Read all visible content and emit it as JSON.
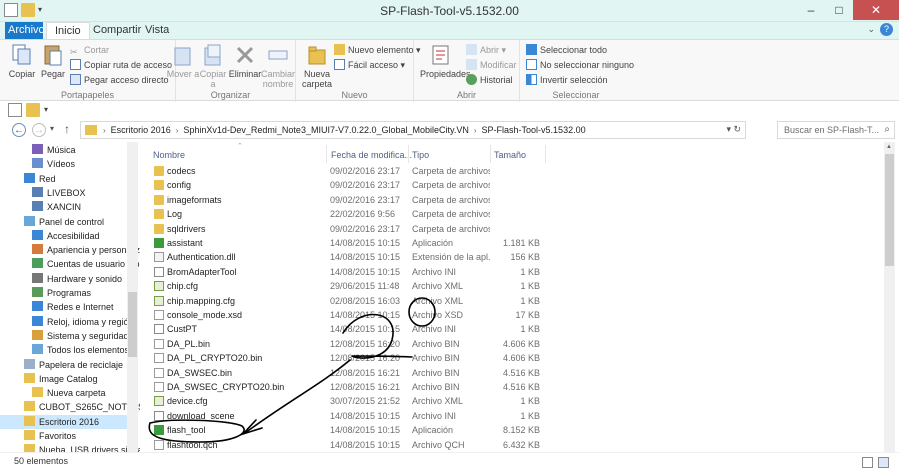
{
  "window": {
    "title": "SP-Flash-Tool-v5.1532.00",
    "minimize": "–",
    "maximize": "□",
    "close": "✕"
  },
  "tabs": [
    "Archivo",
    "Inicio",
    "Compartir",
    "Vista"
  ],
  "ribbon": {
    "portapapeles": {
      "label": "Portapapeles",
      "copiar": "Copiar",
      "pegar": "Pegar",
      "cortar": "Cortar",
      "copiar_ruta": "Copiar ruta de acceso",
      "pegar_acceso": "Pegar acceso directo"
    },
    "organizar": {
      "label": "Organizar",
      "mover": "Mover a",
      "copiar": "Copiar a",
      "eliminar": "Eliminar",
      "cambiar": "Cambiar nombre"
    },
    "nuevo": {
      "label": "Nuevo",
      "nueva_carpeta": "Nueva carpeta",
      "nuevo_elemento": "Nuevo elemento",
      "facil_acceso": "Fácil acceso"
    },
    "abrir": {
      "label": "Abrir",
      "propiedades": "Propiedades",
      "abrir": "Abrir",
      "modificar": "Modificar",
      "historial": "Historial"
    },
    "seleccionar": {
      "label": "Seleccionar",
      "todo": "Seleccionar todo",
      "ninguno": "No seleccionar ninguno",
      "invertir": "Invertir selección"
    }
  },
  "address": {
    "crumbs": [
      "Escritorio 2016",
      "SphinXv1d-Dev_Redmi_Note3_MIUI7-V7.0.22.0_Global_MobileCity.VN",
      "SP-Flash-Tool-v5.1532.00"
    ],
    "search_placeholder": "Buscar en SP-Flash-T..."
  },
  "nav_tree": [
    {
      "label": "Música",
      "icon": "music-icon"
    },
    {
      "label": "Vídeos",
      "icon": "video-icon"
    },
    {
      "label": "Red",
      "icon": "network-icon"
    },
    {
      "label": "LIVEBOX",
      "icon": "computer-icon"
    },
    {
      "label": "XANCIN",
      "icon": "computer-icon"
    },
    {
      "label": "Panel de control",
      "icon": "control-panel-icon"
    },
    {
      "label": "Accesibilidad",
      "icon": "accessibility-icon"
    },
    {
      "label": "Apariencia y personaliz",
      "icon": "appearance-icon"
    },
    {
      "label": "Cuentas de usuario y p",
      "icon": "user-accounts-icon"
    },
    {
      "label": "Hardware y sonido",
      "icon": "hardware-icon"
    },
    {
      "label": "Programas",
      "icon": "programs-icon"
    },
    {
      "label": "Redes e Internet",
      "icon": "network-icon"
    },
    {
      "label": "Reloj, idioma y región",
      "icon": "clock-icon"
    },
    {
      "label": "Sistema y seguridad",
      "icon": "security-icon"
    },
    {
      "label": "Todos los elementos d",
      "icon": "control-panel-icon"
    },
    {
      "label": "Papelera de reciclaje",
      "icon": "recycle-bin-icon"
    },
    {
      "label": "Image Catalog",
      "icon": "folder-icon"
    },
    {
      "label": "Nueva carpeta",
      "icon": "folder-icon"
    },
    {
      "label": "CUBOT_S265C_NOTE_S_",
      "icon": "folder-icon"
    },
    {
      "label": "Escritorio 2016",
      "icon": "folder-icon"
    },
    {
      "label": "Favoritos",
      "icon": "folder-icon"
    },
    {
      "label": "Nueba_USB drivers signa",
      "icon": "folder-icon"
    }
  ],
  "columns": {
    "name": "Nombre",
    "date": "Fecha de modifica...",
    "type": "Tipo",
    "size": "Tamaño"
  },
  "files": [
    {
      "name": "codecs",
      "date": "09/02/2016 23:17",
      "type": "Carpeta de archivos",
      "size": "",
      "kind": "folder"
    },
    {
      "name": "config",
      "date": "09/02/2016 23:17",
      "type": "Carpeta de archivos",
      "size": "",
      "kind": "folder"
    },
    {
      "name": "imageformats",
      "date": "09/02/2016 23:17",
      "type": "Carpeta de archivos",
      "size": "",
      "kind": "folder"
    },
    {
      "name": "Log",
      "date": "22/02/2016 9:56",
      "type": "Carpeta de archivos",
      "size": "",
      "kind": "folder"
    },
    {
      "name": "sqldrivers",
      "date": "09/02/2016 23:17",
      "type": "Carpeta de archivos",
      "size": "",
      "kind": "folder"
    },
    {
      "name": "assistant",
      "date": "14/08/2015 10:15",
      "type": "Aplicación",
      "size": "1.181 KB",
      "kind": "app"
    },
    {
      "name": "Authentication.dll",
      "date": "14/08/2015 10:15",
      "type": "Extensión de la apl...",
      "size": "156 KB",
      "kind": "dll"
    },
    {
      "name": "BromAdapterTool",
      "date": "14/08/2015 10:15",
      "type": "Archivo INI",
      "size": "1 KB",
      "kind": "ini"
    },
    {
      "name": "chip.cfg",
      "date": "29/06/2015 11:48",
      "type": "Archivo XML",
      "size": "1 KB",
      "kind": "xml"
    },
    {
      "name": "chip.mapping.cfg",
      "date": "02/08/2015 16:03",
      "type": "Archivo XML",
      "size": "1 KB",
      "kind": "xml"
    },
    {
      "name": "console_mode.xsd",
      "date": "14/08/2015 10:15",
      "type": "Archivo XSD",
      "size": "17 KB",
      "kind": "doc"
    },
    {
      "name": "CustPT",
      "date": "14/08/2015 10:15",
      "type": "Archivo INI",
      "size": "1 KB",
      "kind": "ini"
    },
    {
      "name": "DA_PL.bin",
      "date": "12/08/2015 16:20",
      "type": "Archivo BIN",
      "size": "4.606 KB",
      "kind": "doc"
    },
    {
      "name": "DA_PL_CRYPTO20.bin",
      "date": "12/08/2015 16:20",
      "type": "Archivo BIN",
      "size": "4.606 KB",
      "kind": "doc"
    },
    {
      "name": "DA_SWSEC.bin",
      "date": "12/08/2015 16:21",
      "type": "Archivo BIN",
      "size": "4.516 KB",
      "kind": "doc"
    },
    {
      "name": "DA_SWSEC_CRYPTO20.bin",
      "date": "12/08/2015 16:21",
      "type": "Archivo BIN",
      "size": "4.516 KB",
      "kind": "doc"
    },
    {
      "name": "device.cfg",
      "date": "30/07/2015 21:52",
      "type": "Archivo XML",
      "size": "1 KB",
      "kind": "xml"
    },
    {
      "name": "download_scene",
      "date": "14/08/2015 10:15",
      "type": "Archivo INI",
      "size": "1 KB",
      "kind": "ini"
    },
    {
      "name": "flash_tool",
      "date": "14/08/2015 10:15",
      "type": "Aplicación",
      "size": "8.152 KB",
      "kind": "app"
    },
    {
      "name": "flashtool.qch",
      "date": "14/08/2015 10:15",
      "type": "Archivo QCH",
      "size": "6.432 KB",
      "kind": "doc"
    }
  ],
  "status": {
    "count": "50 elementos"
  }
}
